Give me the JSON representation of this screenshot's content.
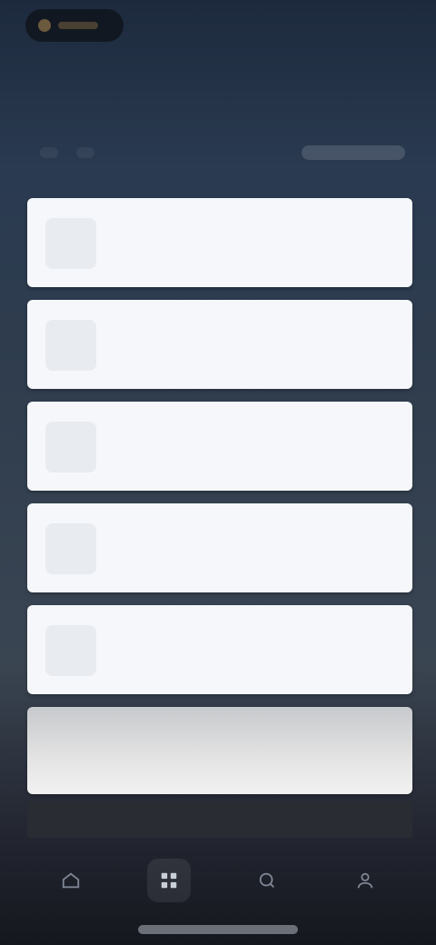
{
  "status": {
    "label": ""
  },
  "header": {
    "title": ""
  },
  "subbar": {
    "tabs": [
      {
        "label": ""
      },
      {
        "label": ""
      }
    ],
    "action_label": ""
  },
  "cards": [
    {
      "title": "",
      "subtitle": ""
    },
    {
      "title": "",
      "subtitle": ""
    },
    {
      "title": "",
      "subtitle": ""
    },
    {
      "title": "",
      "subtitle": ""
    },
    {
      "title": "",
      "subtitle": ""
    },
    {
      "title": "",
      "subtitle": ""
    }
  ],
  "tabbar": {
    "items": [
      {
        "icon": "home-icon"
      },
      {
        "icon": "grid-icon"
      },
      {
        "icon": "search-icon"
      },
      {
        "icon": "profile-icon"
      }
    ]
  },
  "colors": {
    "card_bg": "#f5f7fa",
    "background_top": "#1d2a3e",
    "background_bottom": "#15171e"
  }
}
